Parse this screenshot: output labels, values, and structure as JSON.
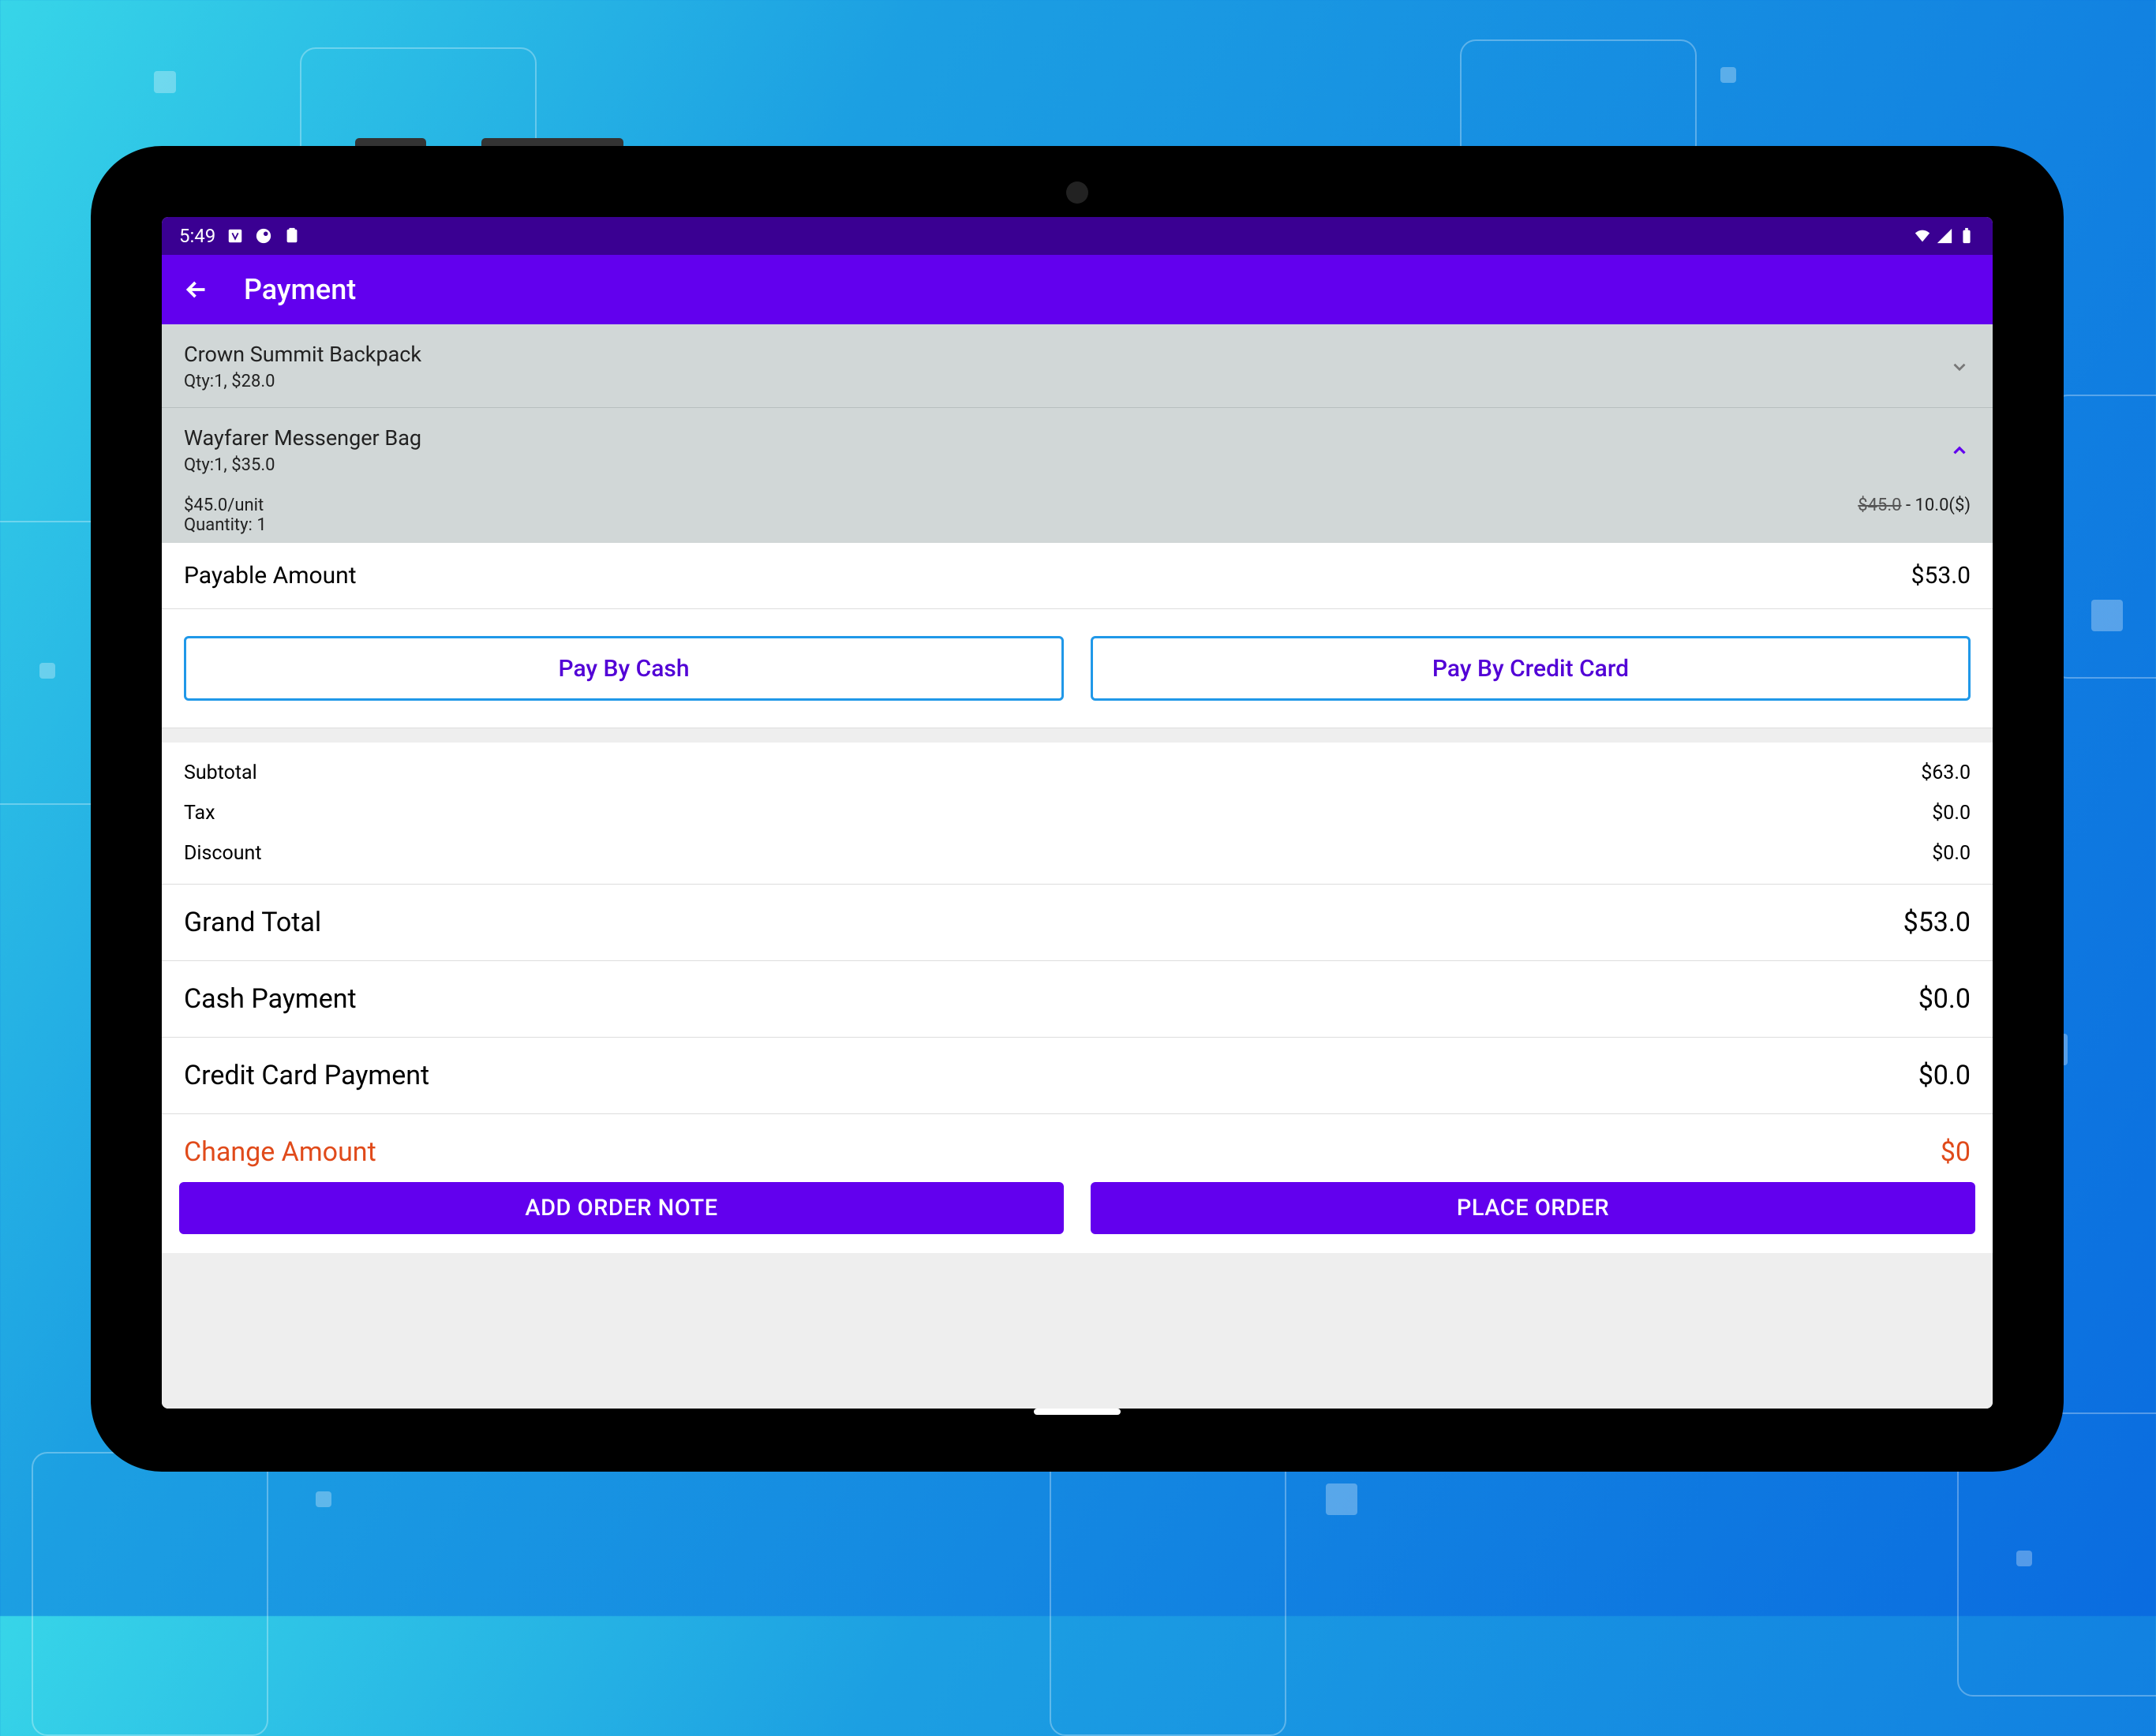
{
  "statusbar": {
    "time": "5:49"
  },
  "appbar": {
    "title": "Payment"
  },
  "cart": [
    {
      "name": "Crown Summit Backpack",
      "sub": "Qty:1,  $28.0",
      "expanded": false
    },
    {
      "name": "Wayfarer Messenger Bag",
      "sub": "Qty:1,  $35.0",
      "expanded": true,
      "detail_left1": "$45.0/unit",
      "detail_left2": "Quantity: 1",
      "detail_strike": "$45.0",
      "detail_disc": " - 10.0($)"
    }
  ],
  "payable": {
    "label": "Payable Amount",
    "value": "$53.0"
  },
  "pay_buttons": {
    "cash": "Pay By Cash",
    "card": "Pay By Credit Card"
  },
  "totals": {
    "subtotal_label": "Subtotal",
    "subtotal": "$63.0",
    "tax_label": "Tax",
    "tax": "$0.0",
    "discount_label": "Discount",
    "discount": "$0.0"
  },
  "summary": {
    "grand_label": "Grand Total",
    "grand": "$53.0",
    "cash_label": "Cash Payment",
    "cash": "$0.0",
    "card_label": "Credit Card Payment",
    "card": "$0.0",
    "change_label": "Change Amount",
    "change": "$0"
  },
  "bottom": {
    "note": "ADD ORDER NOTE",
    "place": "PLACE ORDER"
  }
}
